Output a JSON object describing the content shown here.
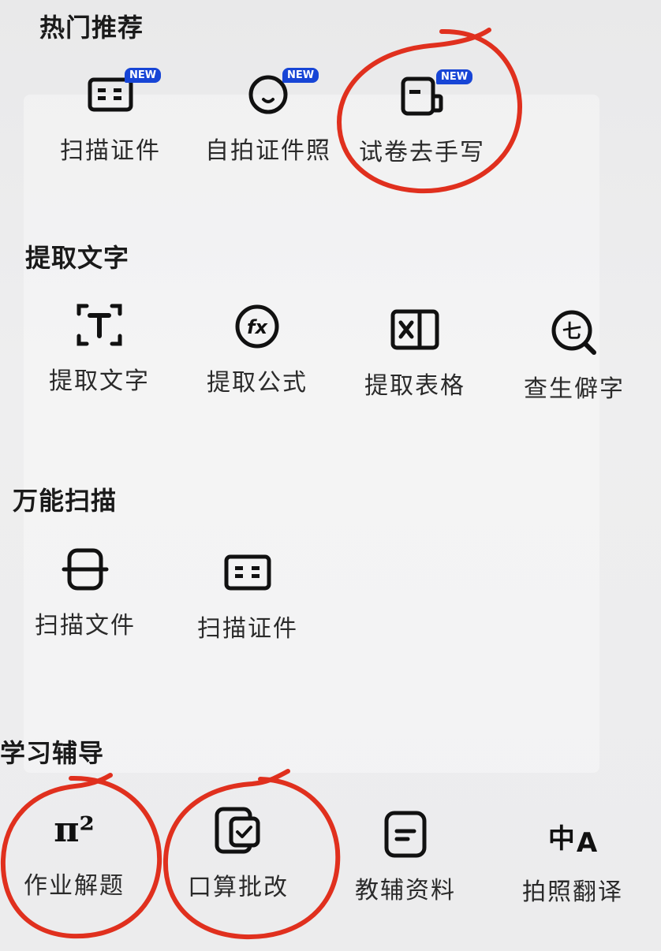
{
  "sections": {
    "hot": {
      "title": "热门推荐",
      "items": [
        {
          "label": "扫描证件",
          "badge": "NEW"
        },
        {
          "label": "自拍证件照",
          "badge": "NEW"
        },
        {
          "label": "试卷去手写",
          "badge": "NEW"
        }
      ]
    },
    "extract": {
      "title": "提取文字",
      "items": [
        {
          "label": "提取文字"
        },
        {
          "label": "提取公式"
        },
        {
          "label": "提取表格"
        },
        {
          "label": "查生僻字"
        }
      ]
    },
    "scan": {
      "title": "万能扫描",
      "items": [
        {
          "label": "扫描文件"
        },
        {
          "label": "扫描证件"
        }
      ]
    },
    "study": {
      "title": "学习辅导",
      "items": [
        {
          "label": "作业解题"
        },
        {
          "label": "口算批改"
        },
        {
          "label": "教辅资料"
        },
        {
          "label": "拍照翻译"
        }
      ]
    }
  },
  "icons": {
    "formula_text": "fx",
    "rare_char_text": "七",
    "translate_glyph_cn": "中",
    "translate_glyph_en": "A",
    "homework_symbol": "π²"
  },
  "colors": {
    "badge": "#1745d6",
    "annotation": "#e0301e"
  }
}
